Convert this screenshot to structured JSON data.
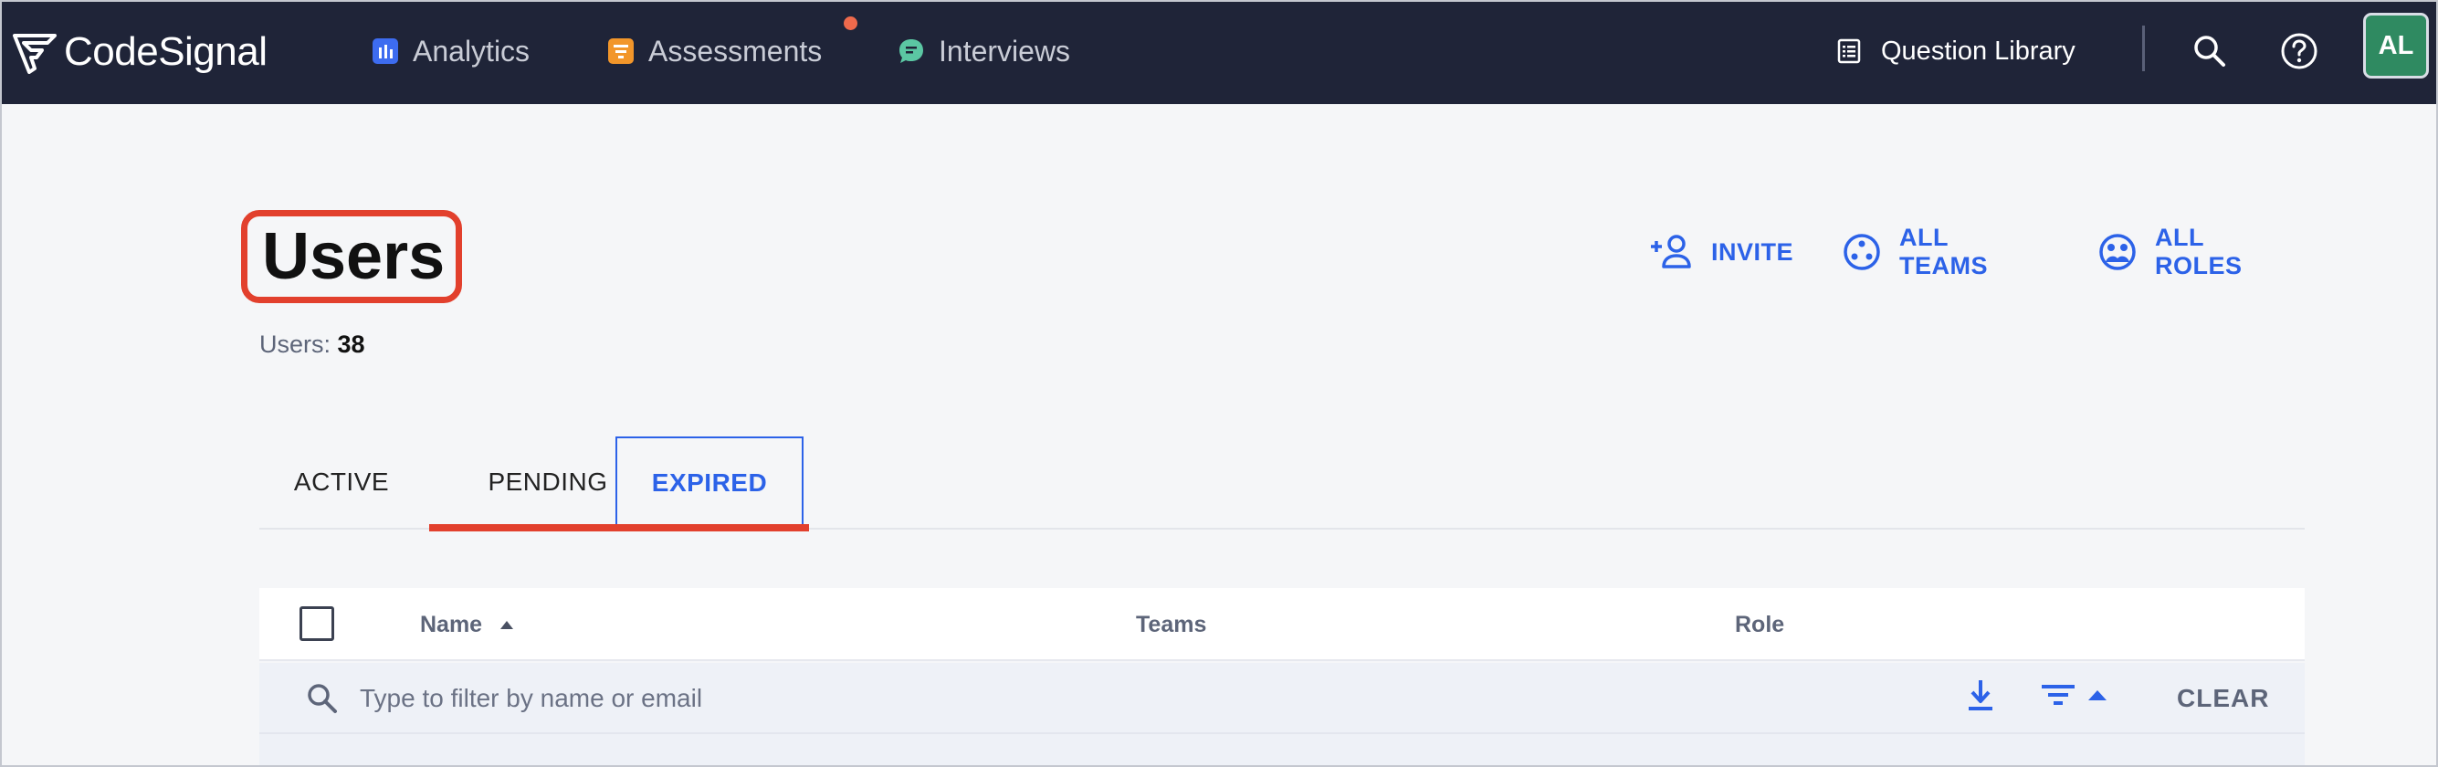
{
  "brand": {
    "name": "CodeSignal"
  },
  "nav": {
    "items": [
      {
        "label": "Analytics",
        "icon": "analytics-icon"
      },
      {
        "label": "Assessments",
        "icon": "assessments-icon",
        "notification": true
      },
      {
        "label": "Interviews",
        "icon": "interviews-icon"
      }
    ],
    "question_library": "Question Library",
    "avatar_initials": "AL"
  },
  "header": {
    "title": "Users",
    "count_label": "Users:",
    "count_value": "38",
    "actions": [
      {
        "label": "INVITE",
        "icon": "add-person-icon"
      },
      {
        "label": "ALL TEAMS",
        "icon": "teams-icon"
      },
      {
        "label": "ALL ROLES",
        "icon": "roles-icon"
      }
    ]
  },
  "tabs": [
    {
      "label": "ACTIVE",
      "selected": false
    },
    {
      "label": "PENDING",
      "selected": false
    },
    {
      "label": "EXPIRED",
      "selected": true
    }
  ],
  "table": {
    "columns": [
      "Name",
      "Teams",
      "Role"
    ],
    "sorted_column": "Name",
    "sort_direction": "ascending",
    "filter_placeholder": "Type to filter by name or email",
    "clear_label": "CLEAR"
  },
  "colors": {
    "nav_bg": "#1f2438",
    "accent_blue": "#2c62e8",
    "highlight_red": "#e2402d",
    "avatar_green": "#2f8a61"
  }
}
